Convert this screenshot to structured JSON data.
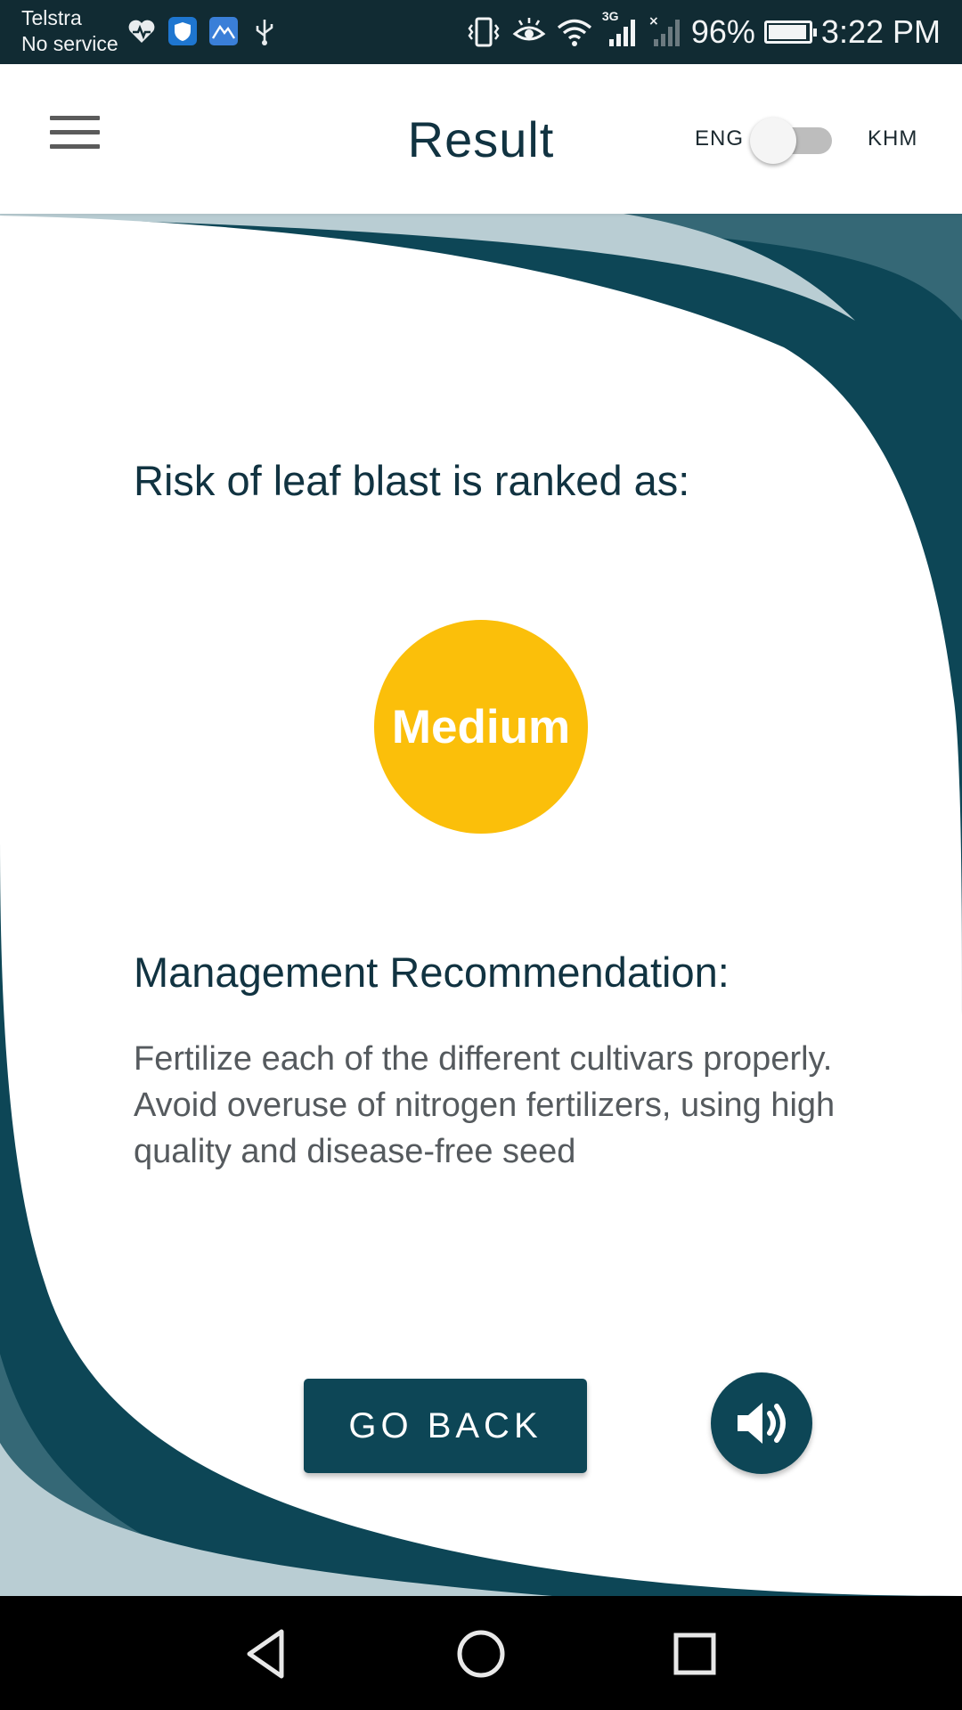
{
  "status_bar": {
    "carrier": "Telstra",
    "service": "No service",
    "network_type": "3G",
    "battery_percent": "96%",
    "battery_level": 0.96,
    "time": "3:22 PM",
    "notification_icons": [
      "health-icon",
      "shield-icon",
      "mountain-icon",
      "usb-icon"
    ],
    "system_icons": [
      "vibrate-icon",
      "eye-comfort-icon",
      "wifi-icon",
      "signal-icon",
      "signal-no-service-icon",
      "battery-icon"
    ]
  },
  "header": {
    "title": "Result",
    "menu_icon": "hamburger-menu-icon",
    "language_left": "ENG",
    "language_right": "KHM",
    "language_toggle_on": false
  },
  "result": {
    "risk_label": "Risk of leaf blast is ranked as:",
    "risk_level": "Medium",
    "risk_color": "#fbbf0a"
  },
  "recommendation": {
    "title": "Management Recommendation:",
    "body": "Fertilize each of the different cultivars properly. Avoid overuse of nitrogen fertilizers, using high quality and disease-free seed"
  },
  "actions": {
    "go_back_label": "GO BACK",
    "audio_icon": "speaker-volume-icon"
  },
  "nav_bar": {
    "icons": [
      "back-icon",
      "home-icon",
      "recents-icon"
    ]
  },
  "colors": {
    "primary": "#0d4656",
    "primary_mid": "#356876",
    "primary_light": "#b9cdd3",
    "status_bar": "#112b33",
    "text_dark": "#113341",
    "text_grey": "#555a5e"
  }
}
